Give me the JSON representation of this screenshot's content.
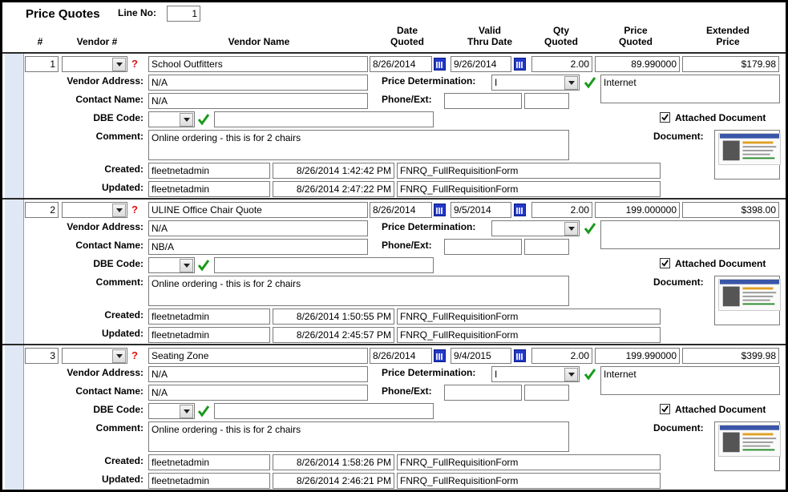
{
  "header": {
    "title": "Price Quotes",
    "line_no_label": "Line No:",
    "line_no_value": "1"
  },
  "columns": {
    "num": "#",
    "vendor_num": "Vendor #",
    "vendor_name": "Vendor Name",
    "date_quoted_1": "Date",
    "date_quoted_2": "Quoted",
    "valid_thru_1": "Valid",
    "valid_thru_2": "Thru Date",
    "qty_1": "Qty",
    "qty_2": "Quoted",
    "price_1": "Price",
    "price_2": "Quoted",
    "ext_1": "Extended",
    "ext_2": "Price"
  },
  "labels": {
    "vendor_address": "Vendor Address:",
    "contact_name": "Contact Name:",
    "dbe_code": "DBE Code:",
    "comment": "Comment:",
    "created": "Created:",
    "updated": "Updated:",
    "price_determination": "Price Determination:",
    "phone_ext": "Phone/Ext:",
    "attached_document": "Attached Document",
    "document": "Document:",
    "help": "?"
  },
  "quotes": [
    {
      "num": "1",
      "vendor_name": "School Outfitters",
      "date_quoted": "8/26/2014",
      "valid_thru": "9/26/2014",
      "qty": "2.00",
      "price": "89.990000",
      "extended": "$179.98",
      "vendor_address": "N/A",
      "price_determination": "I",
      "price_det_note": "Internet",
      "contact_name": "N/A",
      "comment": "Online ordering - this is for 2 chairs",
      "created_by": "fleetnetadmin",
      "created_at": "8/26/2014 1:42:42 PM",
      "created_form": "FNRQ_FullRequisitionForm",
      "updated_by": "fleetnetadmin",
      "updated_at": "8/26/2014 2:47:22 PM",
      "updated_form": "FNRQ_FullRequisitionForm",
      "attached": true
    },
    {
      "num": "2",
      "vendor_name": "ULINE Office Chair Quote",
      "date_quoted": "8/26/2014",
      "valid_thru": "9/5/2014",
      "qty": "2.00",
      "price": "199.000000",
      "extended": "$398.00",
      "vendor_address": "N/A",
      "price_determination": "",
      "price_det_note": "",
      "contact_name": "NB/A",
      "comment": "Online ordering - this is for 2 chairs",
      "created_by": "fleetnetadmin",
      "created_at": "8/26/2014 1:50:55 PM",
      "created_form": "FNRQ_FullRequisitionForm",
      "updated_by": "fleetnetadmin",
      "updated_at": "8/26/2014 2:45:57 PM",
      "updated_form": "FNRQ_FullRequisitionForm",
      "attached": true
    },
    {
      "num": "3",
      "vendor_name": "Seating Zone",
      "date_quoted": "8/26/2014",
      "valid_thru": "9/4/2015",
      "qty": "2.00",
      "price": "199.990000",
      "extended": "$399.98",
      "vendor_address": "N/A",
      "price_determination": "I",
      "price_det_note": "Internet",
      "contact_name": "N/A",
      "comment": "Online ordering - this is for 2 chairs",
      "created_by": "fleetnetadmin",
      "created_at": "8/26/2014 1:58:26 PM",
      "created_form": "FNRQ_FullRequisitionForm",
      "updated_by": "fleetnetadmin",
      "updated_at": "8/26/2014 2:46:21 PM",
      "updated_form": "FNRQ_FullRequisitionForm",
      "attached": true
    }
  ],
  "colors": {
    "left_bar": "#dfe8f4",
    "check_green": "#1a9a1a",
    "help_red": "#e01010",
    "calendar_blue": "#2438c8"
  }
}
